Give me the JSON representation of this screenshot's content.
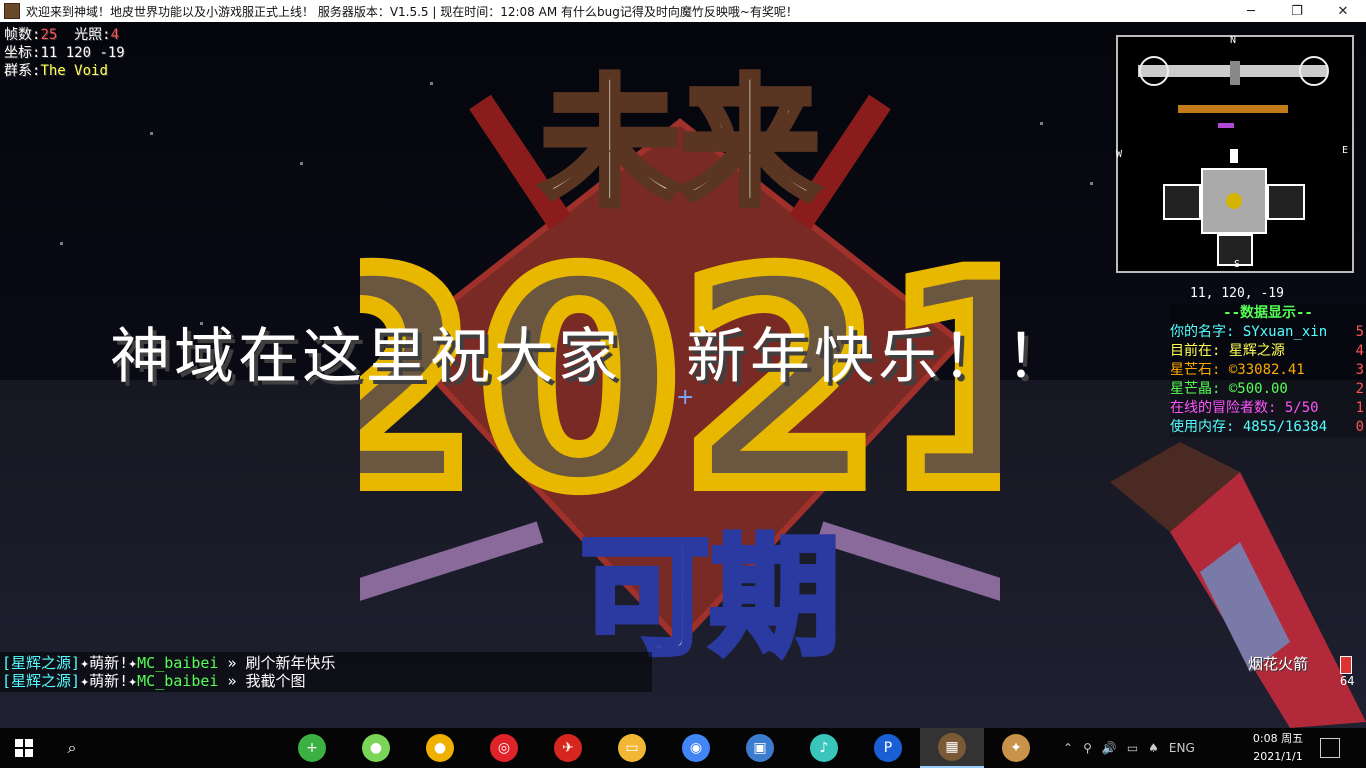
{
  "window": {
    "title": "欢迎来到神域！地皮世界功能以及小游戏服正式上线！    服务器版本：V1.5.5 | 现在时间：12:08 AM  有什么bug记得及时向魔竹反映哦~有奖呢！",
    "min_glyph": "─",
    "max_glyph": "❐",
    "close_glyph": "✕"
  },
  "hud": {
    "fps_label": "帧数:",
    "fps": "25",
    "light_label": "光照:",
    "light": "4",
    "coord_label": "坐标:",
    "coords": "11 120 -19",
    "biome_label": "群系:",
    "biome": "The Void"
  },
  "build_text": {
    "top": "未来",
    "year": "2021",
    "bottom": "可期"
  },
  "banner": "神域在这里祝大家　新年快乐！！",
  "minimap": {
    "n": "N",
    "s": "S",
    "e": "E",
    "w": "W",
    "coords": "11, 120, -19"
  },
  "scoreboard": {
    "title": "--数据显示--",
    "rows": [
      {
        "label": "你的名字: SYxuan_xin",
        "score": "5",
        "color": "#55ffff"
      },
      {
        "label": "目前在: 星辉之源",
        "score": "4",
        "color": "#ffff55"
      },
      {
        "label": "星芒石: ©33082.41",
        "score": "3",
        "color": "#ffaa00"
      },
      {
        "label": "星芒晶: ©500.00",
        "score": "2",
        "color": "#55ff55"
      },
      {
        "label": "在线的冒险者数: 5/50",
        "score": "1",
        "color": "#ff55ff"
      },
      {
        "label": "使用内存: 4855/16384",
        "score": "0",
        "color": "#55ffff"
      }
    ]
  },
  "chat": [
    {
      "channel": "[星辉之源]",
      "rank": "✦萌新!✦",
      "player": "MC_baibei",
      "sep": " » ",
      "msg": "刷个新年快乐"
    },
    {
      "channel": "[星辉之源]",
      "rank": "✦萌新!✦",
      "player": "MC_baibei",
      "sep": " » ",
      "msg": "我截个图"
    }
  ],
  "held_item": {
    "name": "烟花火箭",
    "count": "64"
  },
  "taskbar": {
    "search_glyph": "⌕",
    "apps": [
      {
        "name": "360-icon",
        "glyph": "+",
        "color": "#3cb043"
      },
      {
        "name": "wechat-icon",
        "glyph": "●",
        "color": "#7bd657"
      },
      {
        "name": "qq-icon",
        "glyph": "●",
        "color": "#f0b000"
      },
      {
        "name": "netease-music-icon",
        "glyph": "◎",
        "color": "#e0222b"
      },
      {
        "name": "app-red-icon",
        "glyph": "✈",
        "color": "#d7261e"
      },
      {
        "name": "folder-icon",
        "glyph": "▭",
        "color": "#f2b635"
      },
      {
        "name": "chrome-icon",
        "glyph": "◉",
        "color": "#4285f4"
      },
      {
        "name": "remote-desktop-icon",
        "glyph": "▣",
        "color": "#3c7ccf"
      },
      {
        "name": "miku-icon",
        "glyph": "♪",
        "color": "#39c5bb"
      },
      {
        "name": "p-app-icon",
        "glyph": "P",
        "color": "#1b5fd6"
      },
      {
        "name": "minecraft-icon",
        "glyph": "▦",
        "color": "#7a5a36"
      },
      {
        "name": "launcher-icon",
        "glyph": "✦",
        "color": "#c8924a"
      }
    ],
    "tray": [
      "⌃",
      "⚲",
      "🔊",
      "▭",
      "♠",
      "ENG"
    ],
    "time": "0:08 周五",
    "date": "2021/1/1"
  }
}
